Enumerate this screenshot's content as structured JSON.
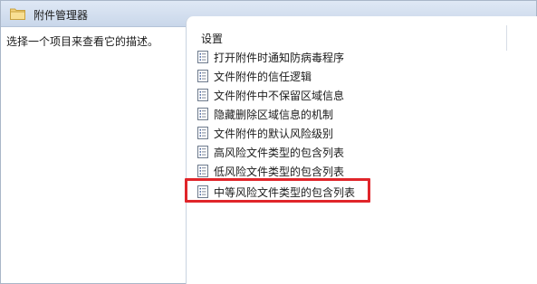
{
  "header": {
    "title": "附件管理器",
    "icon": "folder-icon"
  },
  "left_pane": {
    "description": "选择一个项目来查看它的描述。"
  },
  "list": {
    "column_header": "设置",
    "items": [
      {
        "label": "打开附件时通知防病毒程序",
        "icon": "policy-setting-icon"
      },
      {
        "label": "文件附件的信任逻辑",
        "icon": "policy-setting-icon"
      },
      {
        "label": "文件附件中不保留区域信息",
        "icon": "policy-setting-icon"
      },
      {
        "label": "隐藏删除区域信息的机制",
        "icon": "policy-setting-icon"
      },
      {
        "label": "文件附件的默认风险级别",
        "icon": "policy-setting-icon"
      },
      {
        "label": "高风险文件类型的包含列表",
        "icon": "policy-setting-icon"
      },
      {
        "label": "低风险文件类型的包含列表",
        "icon": "policy-setting-icon"
      },
      {
        "label": "中等风险文件类型的包含列表",
        "icon": "policy-setting-icon"
      }
    ]
  },
  "colors": {
    "highlight_border": "#e0252a",
    "header_bg": "#d4e0f0"
  }
}
